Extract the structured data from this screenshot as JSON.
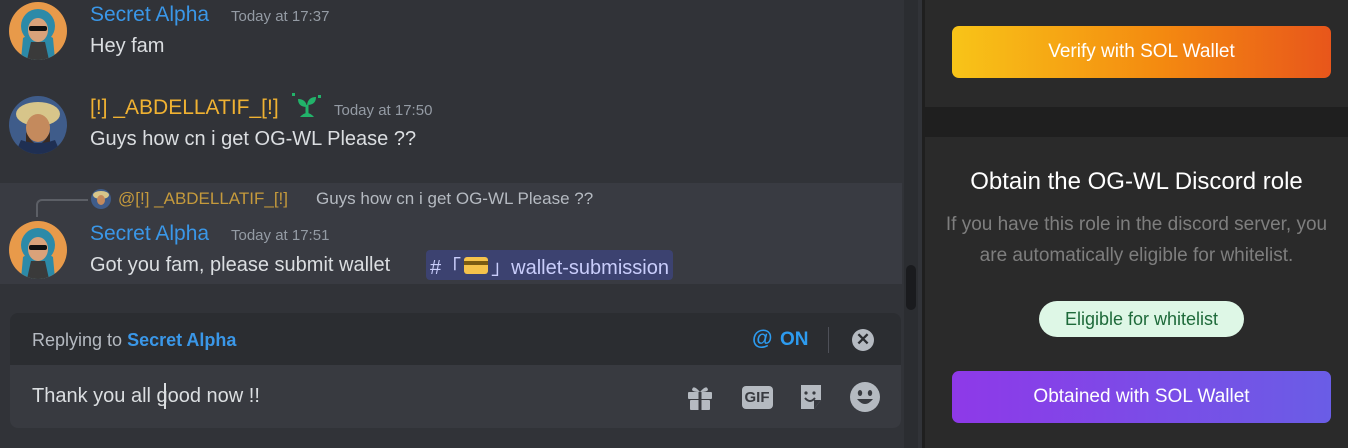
{
  "messages": [
    {
      "author": "Secret Alpha",
      "timestamp": "Today at 17:37",
      "text": "Hey fam",
      "author_color": "#3a97e8"
    },
    {
      "author": "[!] _ABDELLATIF_[!]",
      "timestamp": "Today at 17:50",
      "text": "Guys how cn i get OG-WL Please ??",
      "author_color": "#f0b232",
      "badge_icon": "sprout-icon"
    },
    {
      "reply_to": {
        "author": "@[!] _ABDELLATIF_[!]",
        "text": "Guys how cn i get OG-WL Please ??"
      },
      "author": "Secret Alpha",
      "timestamp": "Today at 17:51",
      "text": "Got you fam, please submit wallet",
      "channel_mention": {
        "prefix": "#「",
        "emoji": "credit-card-icon",
        "suffix": "」wallet-submission"
      }
    }
  ],
  "reply_bar": {
    "replying_label": "Replying to",
    "replying_name": "Secret Alpha",
    "mention_icon": "@",
    "mention_state": "ON",
    "close_icon": "✕"
  },
  "composer": {
    "value": "Thank you all good now !!",
    "tools": [
      "gift-icon",
      "gif-button",
      "sticker-icon",
      "emoji-icon"
    ],
    "gif_label": "GIF"
  },
  "panel": {
    "verify_button": "Verify with SOL Wallet",
    "role_title": "Obtain the OG-WL Discord role",
    "role_description": "If you have this role in the discord server, you are automatically eligible for whitelist.",
    "eligibility_badge": "Eligible for whitelist",
    "obtained_button": "Obtained with SOL Wallet"
  },
  "colors": {
    "chat_bg": "#313338",
    "mention_blue": "#2d9bef",
    "panel_bg": "#1f1f1f",
    "badge_green": "#def7e6"
  }
}
